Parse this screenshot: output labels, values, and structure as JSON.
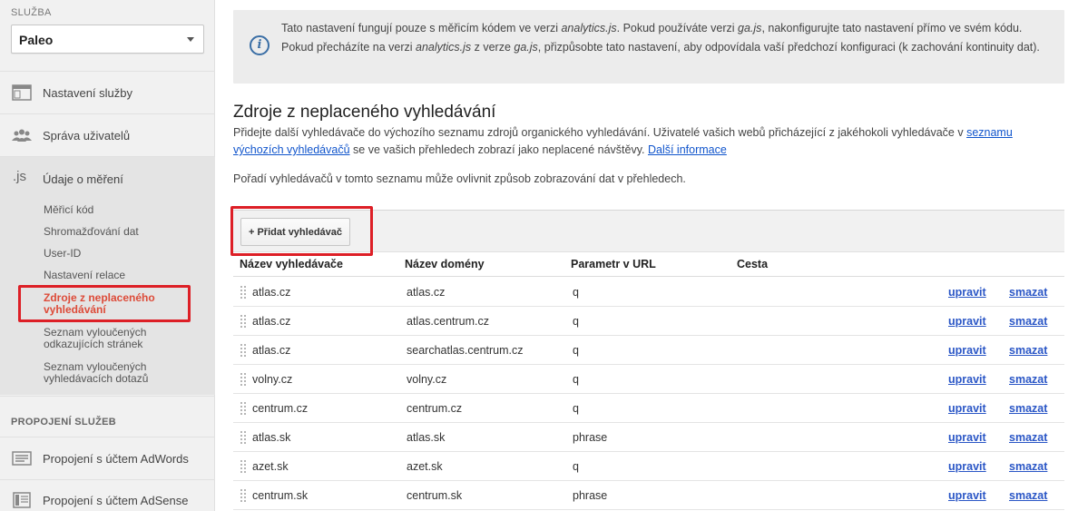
{
  "sidebar": {
    "service_label": "SLUŽBA",
    "service_value": "Paleo",
    "nav": [
      {
        "label": "Nastavení služby",
        "icon": "window-icon"
      },
      {
        "label": "Správa uživatelů",
        "icon": "users-icon"
      },
      {
        "label": "Údaje o měření",
        "icon": "js-icon",
        "icon_text": ".js"
      }
    ],
    "sub_items": [
      "Měřicí kód",
      "Shromažďování dat",
      "User-ID",
      "Nastavení relace",
      "Zdroje z neplaceného vyhledávání",
      "Seznam vyloučených odkazujících stránek",
      "Seznam vyloučených vyhledávacích dotazů"
    ],
    "section_heading": "PROPOJENÍ SLUŽEB",
    "links": [
      {
        "label": "Propojení s účtem AdWords",
        "icon": "adwords-icon"
      },
      {
        "label": "Propojení s účtem AdSense",
        "icon": "adsense-icon"
      }
    ]
  },
  "info": {
    "part1": "Tato nastavení fungují pouze s měřicím kódem ve verzi ",
    "em1": "analytics.js",
    "part2": ". Pokud používáte verzi ",
    "em2": "ga.js",
    "part3": ", nakonfigurujte tato nastavení přímo ve svém kódu. Pokud přecházíte na verzi ",
    "em3": "analytics.js",
    "part4": " z verze ",
    "em4": "ga.js",
    "part5": ", přizpůsobte tato nastavení, aby odpovídala vaší předchozí konfiguraci (k zachování kontinuity dat)."
  },
  "main": {
    "title": "Zdroje z neplaceného vyhledávání",
    "desc_text": "Přidejte další vyhledávače do výchozího seznamu zdrojů organického vyhledávání. Uživatelé vašich webů přicházející z jakéhokoli vyhledávače v ",
    "desc_link": "seznamu výchozích vyhledávačů",
    "desc_text2": " se ve vašich přehledech zobrazí jako neplacené návštěvy. ",
    "desc_more": "Další informace",
    "order_note": "Pořadí vyhledávačů v tomto seznamu může ovlivnit způsob zobrazování dat v přehledech.",
    "add_button": "+ Přidat vyhledávač"
  },
  "table": {
    "headers": {
      "engine": "Název vyhledávače",
      "domain": "Název domény",
      "param": "Parametr v URL",
      "path": "Cesta"
    },
    "edit_label": "upravit",
    "delete_label": "smazat",
    "rows": [
      {
        "engine": "atlas.cz",
        "domain": "atlas.cz",
        "param": "q",
        "path": ""
      },
      {
        "engine": "atlas.cz",
        "domain": "atlas.centrum.cz",
        "param": "q",
        "path": ""
      },
      {
        "engine": "atlas.cz",
        "domain": "searchatlas.centrum.cz",
        "param": "q",
        "path": ""
      },
      {
        "engine": "volny.cz",
        "domain": "volny.cz",
        "param": "q",
        "path": ""
      },
      {
        "engine": "centrum.cz",
        "domain": "centrum.cz",
        "param": "q",
        "path": ""
      },
      {
        "engine": "atlas.sk",
        "domain": "atlas.sk",
        "param": "phrase",
        "path": ""
      },
      {
        "engine": "azet.sk",
        "domain": "azet.sk",
        "param": "q",
        "path": ""
      },
      {
        "engine": "centrum.sk",
        "domain": "centrum.sk",
        "param": "phrase",
        "path": ""
      }
    ]
  },
  "colors": {
    "accent_red": "#dd4b39",
    "link_blue": "#2a56c6",
    "highlight_box": "#dd1f26"
  }
}
